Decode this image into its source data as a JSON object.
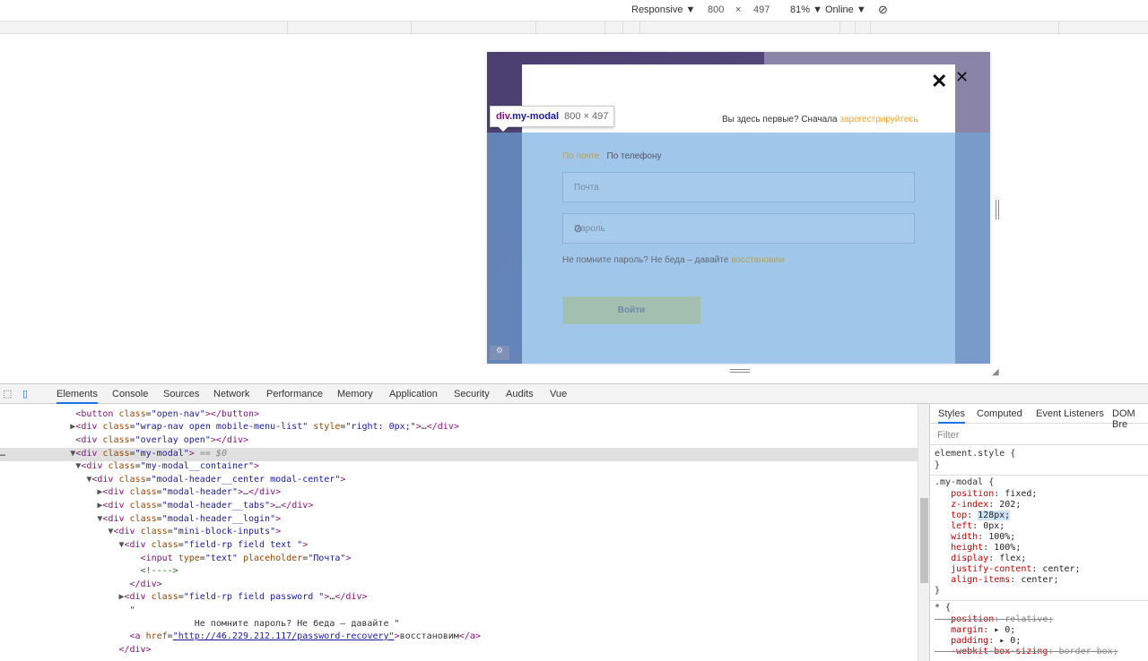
{
  "device_toolbar": {
    "mode": "Responsive",
    "width": "800",
    "times": "×",
    "height": "497",
    "zoom": "81%",
    "network": "Online"
  },
  "page": {
    "first_visit_text": "Вы здесь первые? Сначала ",
    "register_link": "зарегестрируйтесь",
    "tab_email": "По почте",
    "tab_phone": "По телефону",
    "email_placeholder": "Почта",
    "password_placeholder": "Пароль",
    "forgot_text": "Не помните пароль? Не беда – давайте ",
    "restore_link": "восстановим",
    "login_button": "Войти"
  },
  "tooltip": {
    "tag": "div",
    "cls": ".my-modal",
    "dims": "800 × 497"
  },
  "devtools": {
    "tabs": [
      "Elements",
      "Console",
      "Sources",
      "Network",
      "Performance",
      "Memory",
      "Application",
      "Security",
      "Audits",
      "Vue"
    ],
    "styles_tabs": [
      "Styles",
      "Computed",
      "Event Listeners",
      "DOM Bre"
    ],
    "filter_placeholder": "Filter"
  },
  "styles": {
    "element_style": "element.style {",
    "close1": "}",
    "selector": ".my-modal {",
    "props": [
      {
        "p": "position",
        "v": "fixed;"
      },
      {
        "p": "z-index",
        "v": "202;"
      },
      {
        "p": "top",
        "v": "128px;"
      },
      {
        "p": "left",
        "v": "0px;"
      },
      {
        "p": "width",
        "v": "100%;"
      },
      {
        "p": "height",
        "v": "100%;"
      },
      {
        "p": "display",
        "v": "flex;"
      },
      {
        "p": "justify-content",
        "v": "center;"
      },
      {
        "p": "align-items",
        "v": "center;"
      }
    ],
    "close2": "}",
    "star": "* {",
    "star_props": [
      {
        "p": "position",
        "v": "relative;",
        "struck": true
      },
      {
        "p": "margin",
        "v": "▸ 0;"
      },
      {
        "p": "padding",
        "v": "▸ 0;"
      },
      {
        "p": "-webkit-box-sizing",
        "v": "border-box;",
        "struck": true
      }
    ]
  }
}
